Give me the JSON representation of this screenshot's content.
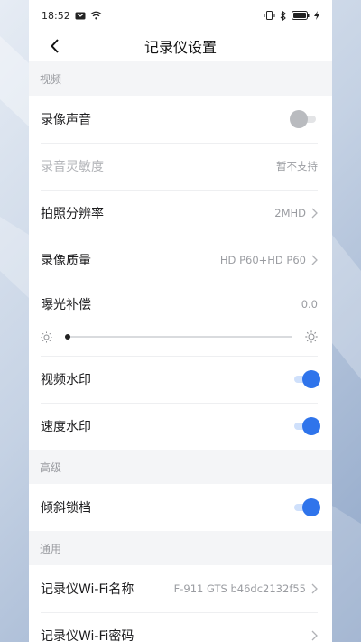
{
  "status_bar": {
    "time": "18:52",
    "icons_left": [
      "notification-icon",
      "wifi-icon"
    ],
    "icons_right": [
      "vibrate-icon",
      "bluetooth-icon",
      "battery-icon",
      "charging-icon"
    ]
  },
  "nav": {
    "title": "记录仪设置",
    "back_icon": "chevron-left-icon"
  },
  "sections": {
    "video": "视频",
    "advanced": "高级",
    "general": "通用"
  },
  "rows": {
    "record_sound": {
      "label": "录像声音",
      "toggle": "off"
    },
    "mic_sensitivity": {
      "label": "录音灵敏度",
      "value": "暂不支持"
    },
    "photo_resolution": {
      "label": "拍照分辨率",
      "value": "2MHD"
    },
    "record_quality": {
      "label": "录像质量",
      "value": "HD P60+HD P60"
    },
    "exposure": {
      "label": "曝光补偿",
      "value": "0.0",
      "slider_position": 0
    },
    "video_watermark": {
      "label": "视频水印",
      "toggle": "on"
    },
    "speed_watermark": {
      "label": "速度水印",
      "toggle": "on"
    },
    "tilt_lock": {
      "label": "倾斜锁档",
      "toggle": "on"
    },
    "wifi_name": {
      "label": "记录仪Wi-Fi名称",
      "value": "F-911 GTS b46dc2132f55"
    },
    "wifi_password": {
      "label": "记录仪Wi-Fi密码",
      "value": ""
    }
  },
  "colors": {
    "accent": "#2f74eb",
    "background": "#f4f5f7"
  }
}
